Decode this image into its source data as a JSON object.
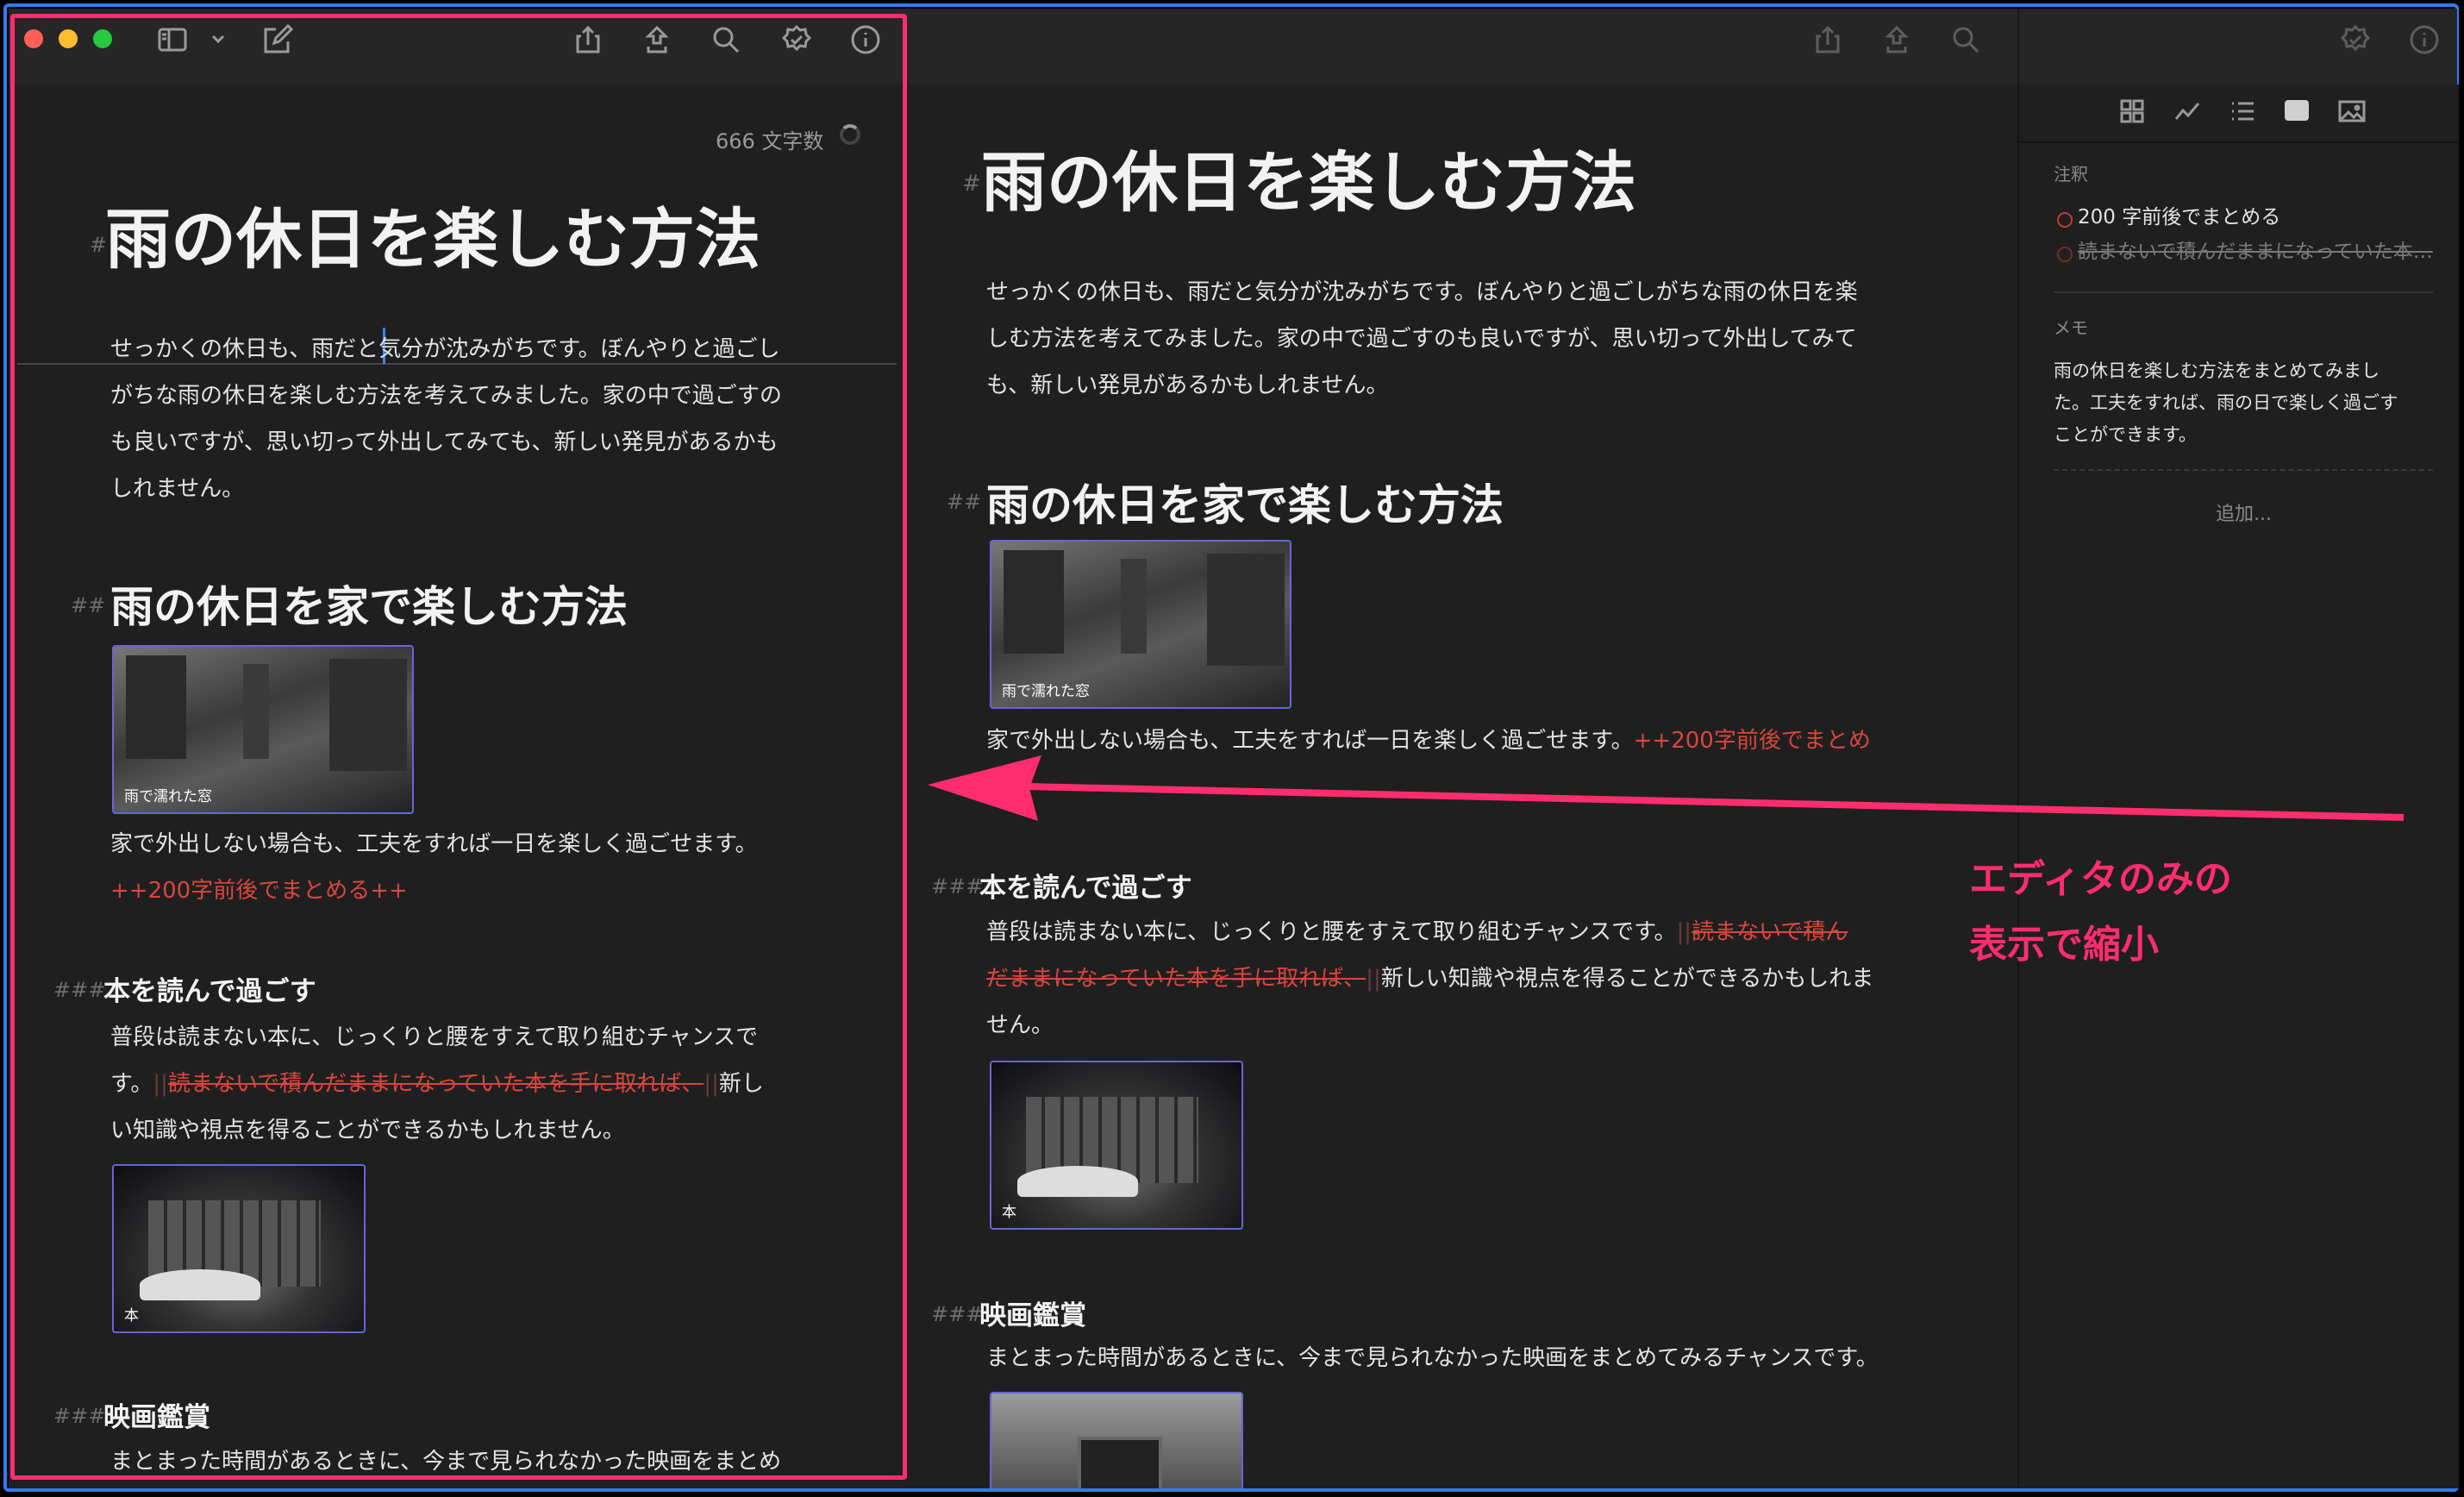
{
  "left": {
    "word_count": "666 文字数",
    "h1": "雨の休日を楽しむ方法",
    "h1_hash": "#",
    "intro": [
      "せっかくの休日も、雨だと気分が沈みがちです。ぼんやりと過ごし",
      "がちな雨の休日を楽しむ方法を考えてみました。家の中で過ごすの",
      "も良いですが、思い切って外出してみても、新しい発見があるかも",
      "しれません。"
    ],
    "h2_hash": "##",
    "h2": "雨の休日を家で楽しむ方法",
    "img1_caption": "雨で濡れた窓",
    "p2": "家で外出しない場合も、工夫をすれば一日を楽しく過ごせます。",
    "p2_note": "++200字前後でまとめる++",
    "h3_hash": "###",
    "h3a": "本を読んで過ごす",
    "p3_line1": "普段は読まない本に、じっくりと腰をすえて取り組むチャンスで",
    "p3_line2_a": "す。",
    "p3_mark_open": "||",
    "p3_strike": "読まないで積んだままになっていた本を手に取れば、",
    "p3_mark_close": "||",
    "p3_line2_b": "新し",
    "p3_line3": "い知識や視点を得ることができるかもしれません。",
    "img2_caption": "本",
    "h3b": "映画鑑賞",
    "p4": "まとまった時間があるときに、今まで見られなかった映画をまとめ"
  },
  "right": {
    "h1_hash": "#",
    "h1": "雨の休日を楽しむ方法",
    "intro": [
      "せっかくの休日も、雨だと気分が沈みがちです。ぼんやりと過ごしがちな雨の休日を楽",
      "しむ方法を考えてみました。家の中で過ごすのも良いですが、思い切って外出してみて",
      "も、新しい発見があるかもしれません。"
    ],
    "h2_hash": "##",
    "h2": "雨の休日を家で楽しむ方法",
    "img1_caption": "雨で濡れた窓",
    "p2": "家で外出しない場合も、工夫をすれば一日を楽しく過ごせます。",
    "p2_note": "++200字前後でまとめ",
    "h3_hash": "###",
    "h3a": "本を読んで過ごす",
    "p3_line1_a": "普段は読まない本に、じっくりと腰をすえて取り組むチャンスです。",
    "p3_mark_open": "||",
    "p3_strike1": "読まないで積ん",
    "p3_strike2": "だままになっていた本を手に取れば、",
    "p3_mark_close": "||",
    "p3_line2_b": "新しい知識や視点を得ることができるかもしれま",
    "p3_line3": "せん。",
    "img2_caption": "本",
    "h3b": "映画鑑賞",
    "p4": "まとまった時間があるときに、今まで見られなかった映画をまとめてみるチャンスです。"
  },
  "sidebar": {
    "annotations_label": "注釈",
    "annotation1": "200 字前後でまとめる",
    "annotation2": "読まないで積んだままになっていた本…",
    "memo_label": "メモ",
    "memo": [
      "雨の休日を楽しむ方法をまとめてみまし",
      "た。工夫をすれば、雨の日で楽しく過ごす",
      "ことができます。"
    ],
    "add": "追加..."
  },
  "callout": {
    "line1": "エディタのみの",
    "line2": "表示で縮小"
  },
  "colors": {
    "accent_pink": "#ff2d6f",
    "accent_blue": "#2f7bf5",
    "strike_red": "#d9463e",
    "image_border": "#6b63d8"
  }
}
